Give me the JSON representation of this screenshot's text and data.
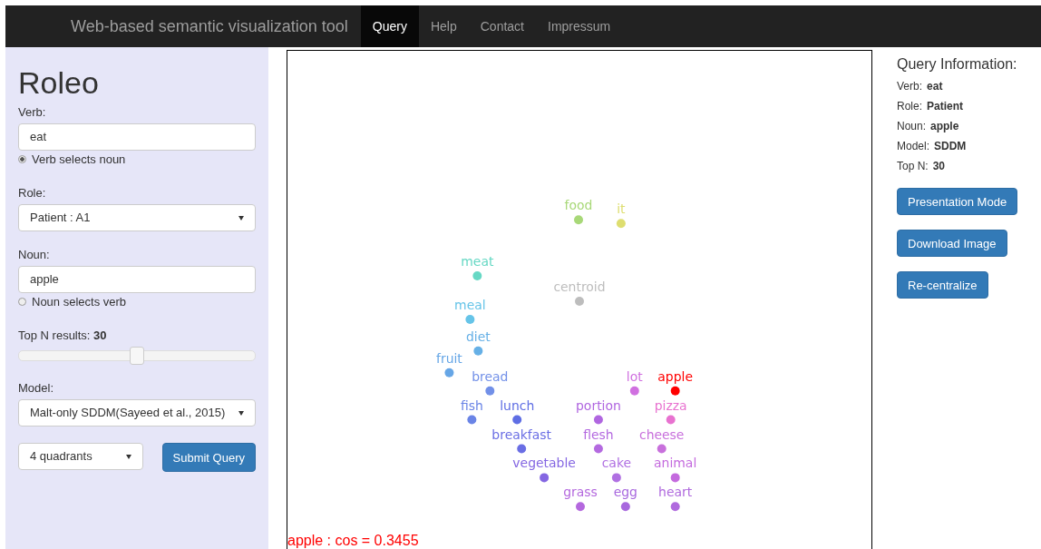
{
  "navbar": {
    "brand": "Web-based semantic visualization tool",
    "items": [
      {
        "label": "Query",
        "selected": true
      },
      {
        "label": "Help",
        "selected": false
      },
      {
        "label": "Contact",
        "selected": false
      },
      {
        "label": "Impressum",
        "selected": false
      }
    ]
  },
  "sidebar": {
    "title": "Roleo",
    "verb": {
      "label": "Verb:",
      "value": "eat"
    },
    "verb_option": {
      "label": "Verb selects noun",
      "selected": true
    },
    "role": {
      "label": "Role:",
      "value": "Patient : A1"
    },
    "noun": {
      "label": "Noun:",
      "value": "apple"
    },
    "noun_option": {
      "label": "Noun selects verb",
      "selected": false
    },
    "top_n": {
      "label": "Top N results: **30**",
      "level": 0.5
    },
    "model": {
      "label": "Model:",
      "value": "Malt-only SDDM(Sayeed et al., 2015)"
    },
    "layout": {
      "value": "4 quadrants"
    },
    "submit": "Submit Query"
  },
  "plot": {
    "points": [
      {
        "label": "food",
        "color": "#a8d878"
      },
      {
        "label": "it",
        "color": "#dede70"
      },
      {
        "label": "meat",
        "color": "#66d8c4"
      },
      {
        "label": "centroid",
        "color": "#bdbdbd"
      },
      {
        "label": "meal",
        "color": "#66c4e8"
      },
      {
        "label": "diet",
        "color": "#66b0e6"
      },
      {
        "label": "fruit",
        "color": "#66a6e6"
      },
      {
        "label": "bread",
        "color": "#7290e8"
      },
      {
        "label": "fish",
        "color": "#6a84e6"
      },
      {
        "label": "lunch",
        "color": "#5f6ee4"
      },
      {
        "label": "breakfast",
        "color": "#6a6ee4"
      },
      {
        "label": "vegetable",
        "color": "#8466e2"
      },
      {
        "label": "portion",
        "color": "#b066e0"
      },
      {
        "label": "lot",
        "color": "#d070e0"
      },
      {
        "label": "apple",
        "color": "#ff0000"
      },
      {
        "label": "pizza",
        "color": "#e872d0"
      },
      {
        "label": "flesh",
        "color": "#b46ae0"
      },
      {
        "label": "cake",
        "color": "#b070e2"
      },
      {
        "label": "cheese",
        "color": "#c870dc"
      },
      {
        "label": "animal",
        "color": "#c46ade"
      },
      {
        "label": "grass",
        "color": "#b468de"
      },
      {
        "label": "egg",
        "color": "#a868de"
      },
      {
        "label": "heart",
        "color": "#b06ade"
      }
    ],
    "footer": "apple : cos = 0.3455"
  },
  "query_info": {
    "title": "Query Information:",
    "rows": [
      {
        "label": "Verb:",
        "value": "eat"
      },
      {
        "label": "Role:",
        "value": "Patient"
      },
      {
        "label": "Noun:",
        "value": "apple"
      },
      {
        "label": "Model:",
        "value": "SDDM"
      },
      {
        "label": "Top N:",
        "value": "30"
      }
    ],
    "buttons": [
      "Presentation Mode",
      "Download Image",
      "Re-centralize"
    ]
  }
}
